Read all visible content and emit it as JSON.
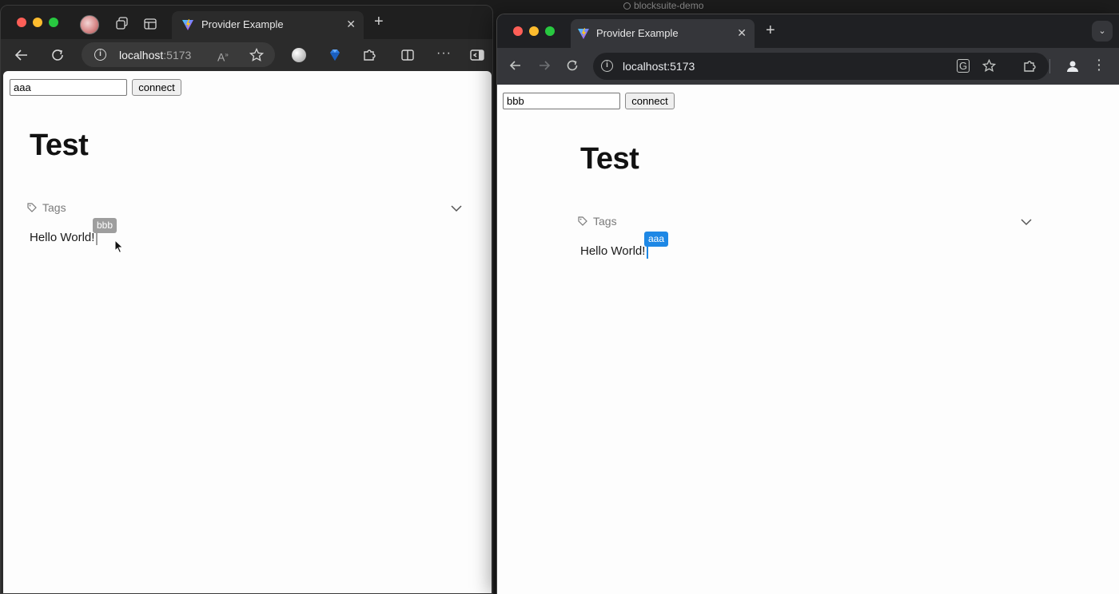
{
  "background": {
    "title": "blocksuite-demo"
  },
  "left_window": {
    "browser": "Microsoft Edge",
    "tab": {
      "title": "Provider Example"
    },
    "url": {
      "host": "localhost",
      "port": ":5173"
    },
    "page": {
      "input_value": "aaa",
      "connect_label": "connect",
      "doc_title": "Test",
      "tags_label": "Tags",
      "body_text": "Hello World!",
      "remote_cursor": {
        "name": "bbb",
        "color": "#9e9e9e"
      }
    }
  },
  "right_window": {
    "browser": "Google Chrome",
    "tab": {
      "title": "Provider Example"
    },
    "url": {
      "host": "localhost:5173"
    },
    "page": {
      "input_value": "bbb",
      "connect_label": "connect",
      "doc_title": "Test",
      "tags_label": "Tags",
      "body_text": "Hello World!",
      "remote_cursor": {
        "name": "aaa",
        "color": "#1e88e5"
      }
    }
  },
  "colors": {
    "mac_close": "#fe5f57",
    "mac_minimize": "#febc2e",
    "mac_zoom": "#28c840"
  }
}
